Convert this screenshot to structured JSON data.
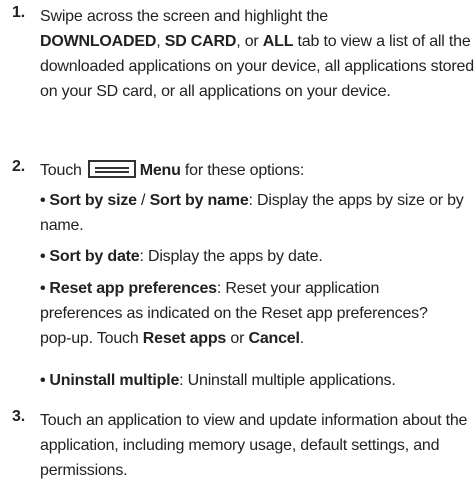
{
  "step1": {
    "number": "1.",
    "t1": "Swipe across the screen and highlight the",
    "b1": "DOWNLOADED",
    "t2": ", ",
    "b2": "SD CARD",
    "t3": ", or ",
    "b3": "ALL",
    "t4": " tab to view a list of all the downloaded applications on your device, all applications stored on your SD card, or all applications on your device."
  },
  "step2": {
    "number": "2.",
    "t1": "Touch",
    "icon": "menu-icon",
    "b1": "Menu",
    "t2": " for these options:",
    "bullets": [
      {
        "b1": "Sort by size",
        "t1": " / ",
        "b2": "Sort by name",
        "t2": ": Display the apps by size or by name."
      },
      {
        "b1": "Sort by date",
        "t1": ": Display the apps by date."
      },
      {
        "b1": "Reset app preferences",
        "t1": ": Reset your application preferences as indicated on the Reset app preferences? pop-up. Touch ",
        "b2": "Reset apps",
        "t2": " or ",
        "b3": "Cancel",
        "t3": "."
      },
      {
        "b1": "Uninstall multiple",
        "t1": ": Uninstall multiple applications."
      }
    ]
  },
  "step3": {
    "number": "3.",
    "text": "Touch an application to view and update information about the application, including memory usage, default settings, and permissions."
  },
  "colors": {
    "text": "#222222",
    "icon": "#333333"
  }
}
